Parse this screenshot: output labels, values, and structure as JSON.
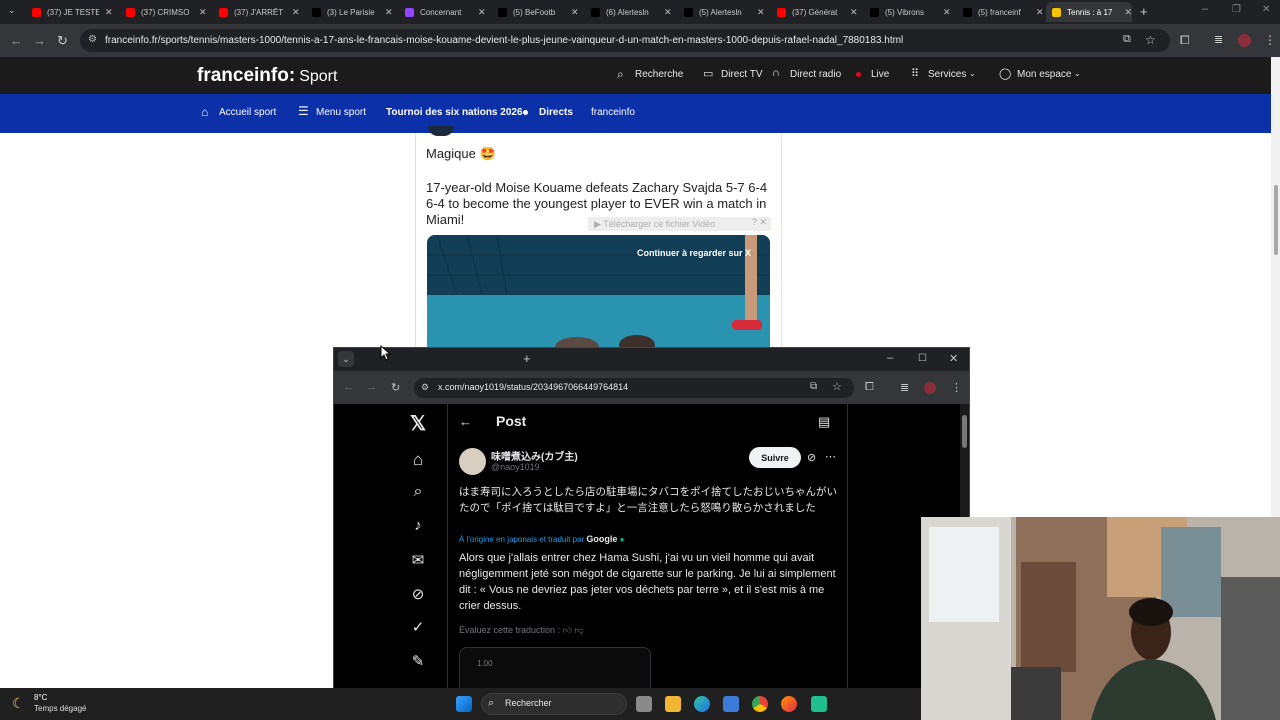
{
  "browser": {
    "tabs": [
      {
        "title": "(37) JE TESTE",
        "icon": "youtube-icon",
        "color": "#ff0000"
      },
      {
        "title": "(37) CRIMSO",
        "icon": "youtube-icon",
        "color": "#ff0000"
      },
      {
        "title": "(37) J'ARRÊT",
        "icon": "youtube-icon",
        "color": "#ff0000"
      },
      {
        "title": "(3) Le Parisie",
        "icon": "x-icon",
        "color": "#000000"
      },
      {
        "title": "Concernant",
        "icon": "twitch-icon",
        "color": "#9146ff"
      },
      {
        "title": "(5) BeFootb",
        "icon": "x-icon",
        "color": "#000000"
      },
      {
        "title": "(6) Alertesln",
        "icon": "x-icon",
        "color": "#000000"
      },
      {
        "title": "(5) Alertesln",
        "icon": "x-icon",
        "color": "#000000"
      },
      {
        "title": "(37) Générat",
        "icon": "youtube-icon",
        "color": "#ff0000"
      },
      {
        "title": "(5) Vibrons",
        "icon": "x-icon",
        "color": "#000000"
      },
      {
        "title": "(5) franceinf",
        "icon": "x-icon",
        "color": "#000000"
      },
      {
        "title": "Tennis : à 17",
        "icon": "franceinfo-icon",
        "color": "#f5c400"
      }
    ],
    "url": "franceinfo.fr/sports/tennis/masters-1000/tennis-a-17-ans-le-francais-moise-kouame-devient-le-plus-jeune-vainqueur-d-un-match-en-masters-1000-depuis-rafael-nadal_7880183.html"
  },
  "site": {
    "logo": "franceinfo:",
    "section": "Sport",
    "nav": {
      "search": "Recherche",
      "direct_tv": "Direct TV",
      "direct_radio": "Direct radio",
      "live": "Live",
      "services": "Services",
      "account": "Mon espace"
    },
    "subnav": {
      "home": "Accueil sport",
      "menu": "Menu sport",
      "tournament": "Tournoi des six nations 2026",
      "directs": "Directs",
      "franceinfo": "franceinfo"
    },
    "colors": {
      "header": "#1b1b1b",
      "subnav": "#0b30a8"
    }
  },
  "embedded_tweet": {
    "line1": "Magique 🤩",
    "text": "17-year-old Moise Kouame defeats Zachary Svajda 5-7 6-4 6-4 to become the youngest player to EVER win a match in Miami!",
    "download_label": "▶ Télécharger ce fichier Vidéo",
    "continue_label": "Continuer à regarder sur X"
  },
  "popup": {
    "url": "x.com/naoy1019/status/2034967066449764814",
    "new_tab": "+",
    "page_title": "Post",
    "author_name": "味噌煮込み(カブ主)",
    "author_handle": "@naoy1019",
    "follow_label": "Suivre",
    "original_text": "はま寿司に入ろうとしたら店の駐車場にタバコをポイ捨てしたおじいちゃんがいたので「ポイ捨ては駄目ですよ」と一言注意したら怒鳴り散らかされました",
    "translation_meta": "À l'origine en japonais et traduit par",
    "translator": "Google",
    "translated_text": "Alors que j'allais entrer chez Hama Sushi, j'ai vu un vieil homme qui avait négligemment jeté son mégot de cigarette sur le parking. Je lui ai simplement dit : « Vous ne devriez pas jeter vos déchets par terre », et il s'est mis à me crier dessus.",
    "rate_label": "Évaluez cette traduction :",
    "media_label": "1.00"
  },
  "taskbar": {
    "temperature": "8°C",
    "weather": "Temps dégagé",
    "search_label": "Rechercher"
  }
}
